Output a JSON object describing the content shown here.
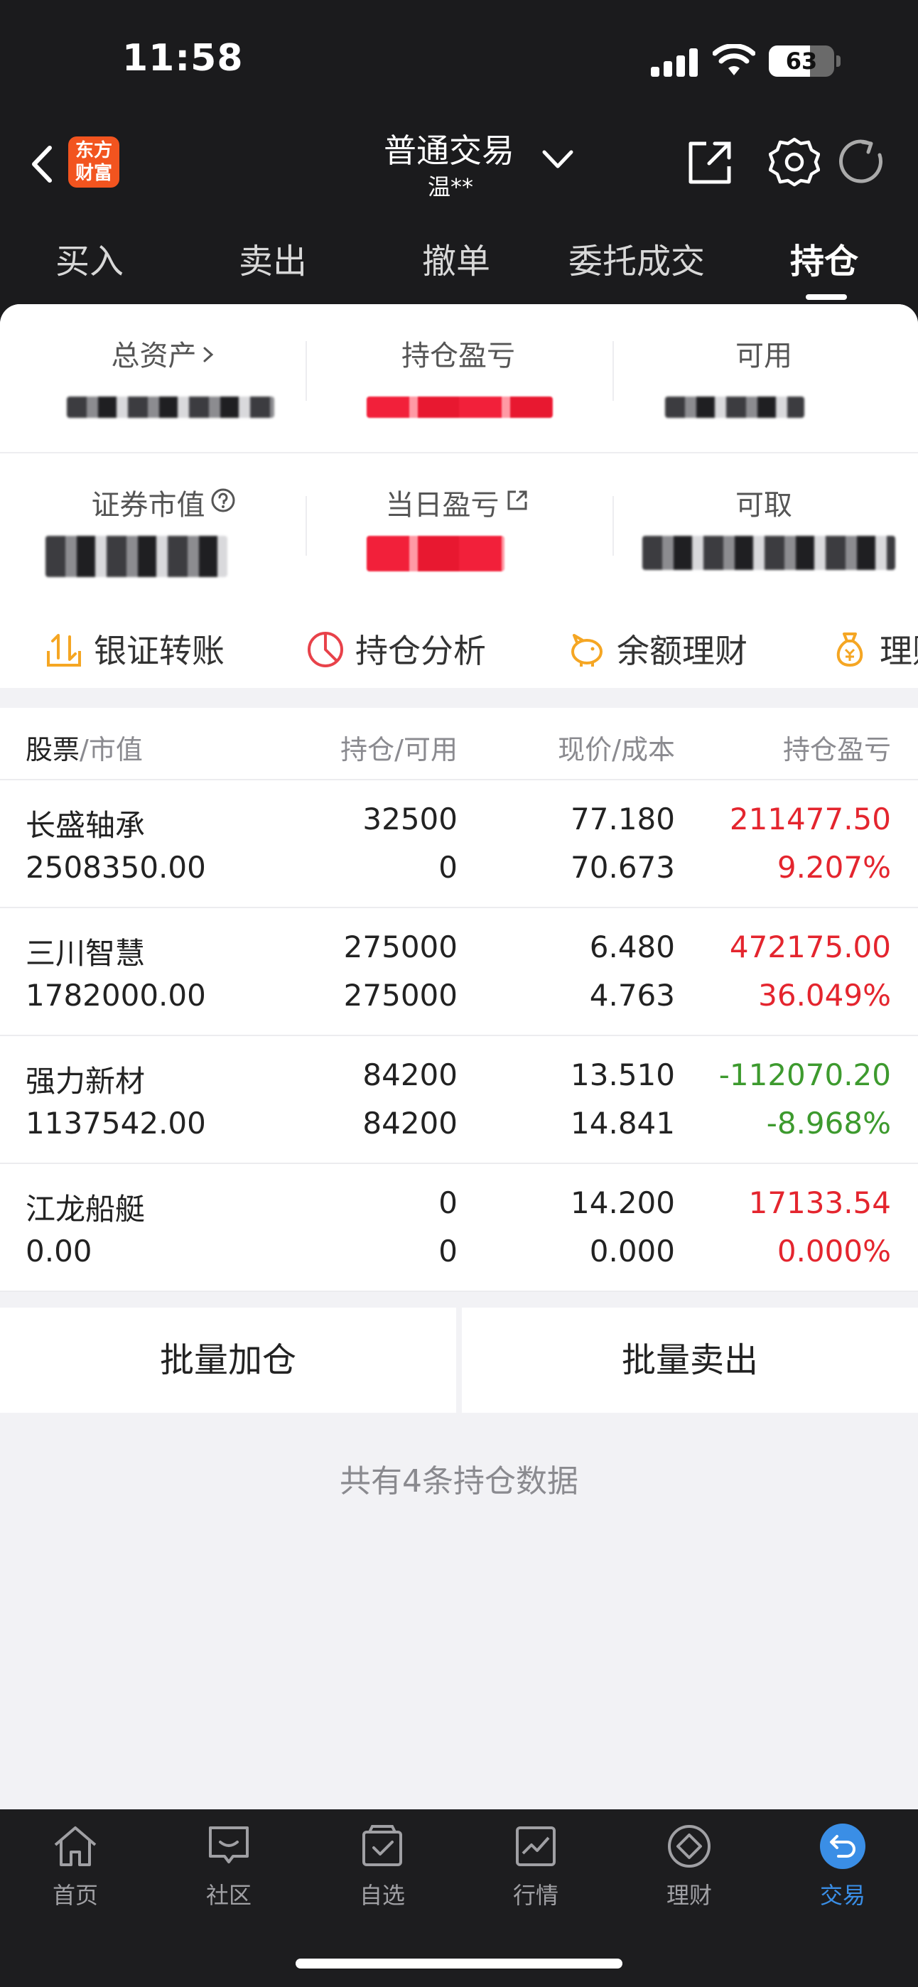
{
  "status_bar": {
    "time": "11:58",
    "battery": "63"
  },
  "header": {
    "logo_line1": "东方",
    "logo_line2": "财富",
    "title": "普通交易",
    "subtitle": "温**"
  },
  "tabs": [
    {
      "label": "买入"
    },
    {
      "label": "卖出"
    },
    {
      "label": "撤单"
    },
    {
      "label": "委托成交"
    },
    {
      "label": "持仓",
      "active": true
    }
  ],
  "summary": {
    "total_assets_label": "总资产",
    "holding_pl_label": "持仓盈亏",
    "available_label": "可用",
    "market_value_label": "证券市值",
    "daily_pl_label": "当日盈亏",
    "withdrawable_label": "可取"
  },
  "quick_actions": [
    {
      "label": "银证转账",
      "icon": "transfer-icon"
    },
    {
      "label": "持仓分析",
      "icon": "pie-chart-icon"
    },
    {
      "label": "余额理财",
      "icon": "piggy-bank-icon"
    },
    {
      "label": "理财",
      "icon": "money-bag-icon"
    }
  ],
  "table": {
    "headers": {
      "stock": "股票",
      "market_value": "市值",
      "holding": "持仓",
      "available": "可用",
      "price": "现价",
      "cost": "成本",
      "pl": "持仓盈亏"
    },
    "rows": [
      {
        "name": "长盛轴承",
        "market_value": "2508350.00",
        "holding": "32500",
        "available": "0",
        "price": "77.180",
        "cost": "70.673",
        "pl": "211477.50",
        "pl_pct": "9.207%",
        "trend": "up"
      },
      {
        "name": "三川智慧",
        "market_value": "1782000.00",
        "holding": "275000",
        "available": "275000",
        "price": "6.480",
        "cost": "4.763",
        "pl": "472175.00",
        "pl_pct": "36.049%",
        "trend": "up"
      },
      {
        "name": "强力新材",
        "market_value": "1137542.00",
        "holding": "84200",
        "available": "84200",
        "price": "13.510",
        "cost": "14.841",
        "pl": "-112070.20",
        "pl_pct": "-8.968%",
        "trend": "down"
      },
      {
        "name": "江龙船艇",
        "market_value": "0.00",
        "holding": "0",
        "available": "0",
        "price": "14.200",
        "cost": "0.000",
        "pl": "17133.54",
        "pl_pct": "0.000%",
        "trend": "up"
      }
    ]
  },
  "batch": {
    "add_label": "批量加仓",
    "sell_label": "批量卖出"
  },
  "footer_text": "共有4条持仓数据",
  "tabbar": [
    {
      "label": "首页",
      "icon": "home-icon"
    },
    {
      "label": "社区",
      "icon": "community-icon"
    },
    {
      "label": "自选",
      "icon": "watchlist-icon"
    },
    {
      "label": "行情",
      "icon": "market-icon"
    },
    {
      "label": "理财",
      "icon": "finance-icon"
    },
    {
      "label": "交易",
      "icon": "trade-icon",
      "active": true
    }
  ],
  "colors": {
    "up": "#e4252e",
    "down": "#3d9a2e",
    "accent": "#3a8ee6",
    "brand": "#f2541f"
  }
}
